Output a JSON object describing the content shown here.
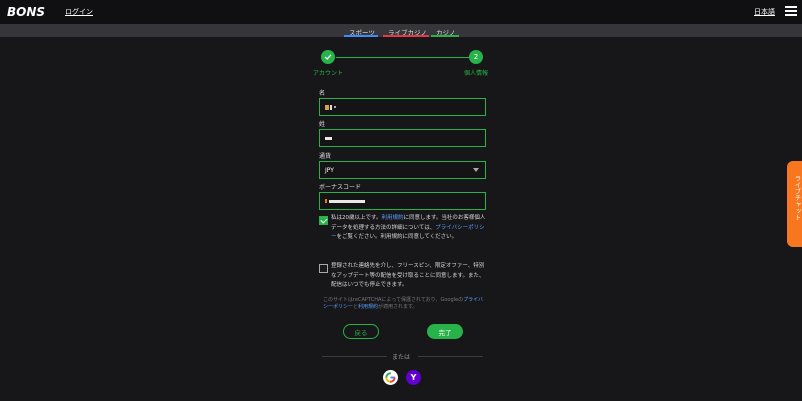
{
  "header": {
    "logo": "BONS",
    "login_label": "ログイン",
    "language_label": "日本語"
  },
  "nav": {
    "tabs": [
      {
        "label": "スポーツ",
        "color": "#3d8bff"
      },
      {
        "label": "ライブカジノ",
        "color": "#e63946"
      },
      {
        "label": "カジノ",
        "color": "#27b34a"
      }
    ]
  },
  "steps": [
    {
      "label": "アカウント",
      "status": "done"
    },
    {
      "label": "個人情報",
      "number": "2",
      "status": "active"
    }
  ],
  "form": {
    "first_name_label": "名",
    "last_name_label": "姓",
    "currency_label": "通貨",
    "currency_value": "JPY",
    "bonus_code_label": "ボーナスコード"
  },
  "consent": {
    "terms_pre": "私は20歳以上です。",
    "terms_link": "利用規約",
    "terms_mid": "に同意します。当社のお客様個人データを処理する方法の詳細については、",
    "privacy_link": "プライバシーポリシー",
    "terms_post": "をご覧ください。利用規約に同意してください。",
    "terms_checked": true,
    "marketing_text": "登録された連絡先を介し、フリースピン、限定オファー、特別なアップデート等の配信を受け取ることに同意します。また、配信はいつでも停止できます。",
    "marketing_checked": false
  },
  "captcha": {
    "pre": "このサイトはreCAPTCHAによって保護されており、Googleの",
    "privacy_link": "プライバシーポリシー",
    "mid": "と",
    "terms_link": "利用規約",
    "post": "が適用されます。"
  },
  "actions": {
    "back_label": "戻る",
    "done_label": "完了"
  },
  "social": {
    "or_label": "または",
    "providers": [
      "google-icon",
      "yahoo-icon"
    ],
    "yahoo_glyph": "Y"
  },
  "live_chat": {
    "label": "ライブチャット"
  },
  "colors": {
    "accent": "#27b34a",
    "link": "#5aa0ff",
    "chat": "#f7761e"
  }
}
